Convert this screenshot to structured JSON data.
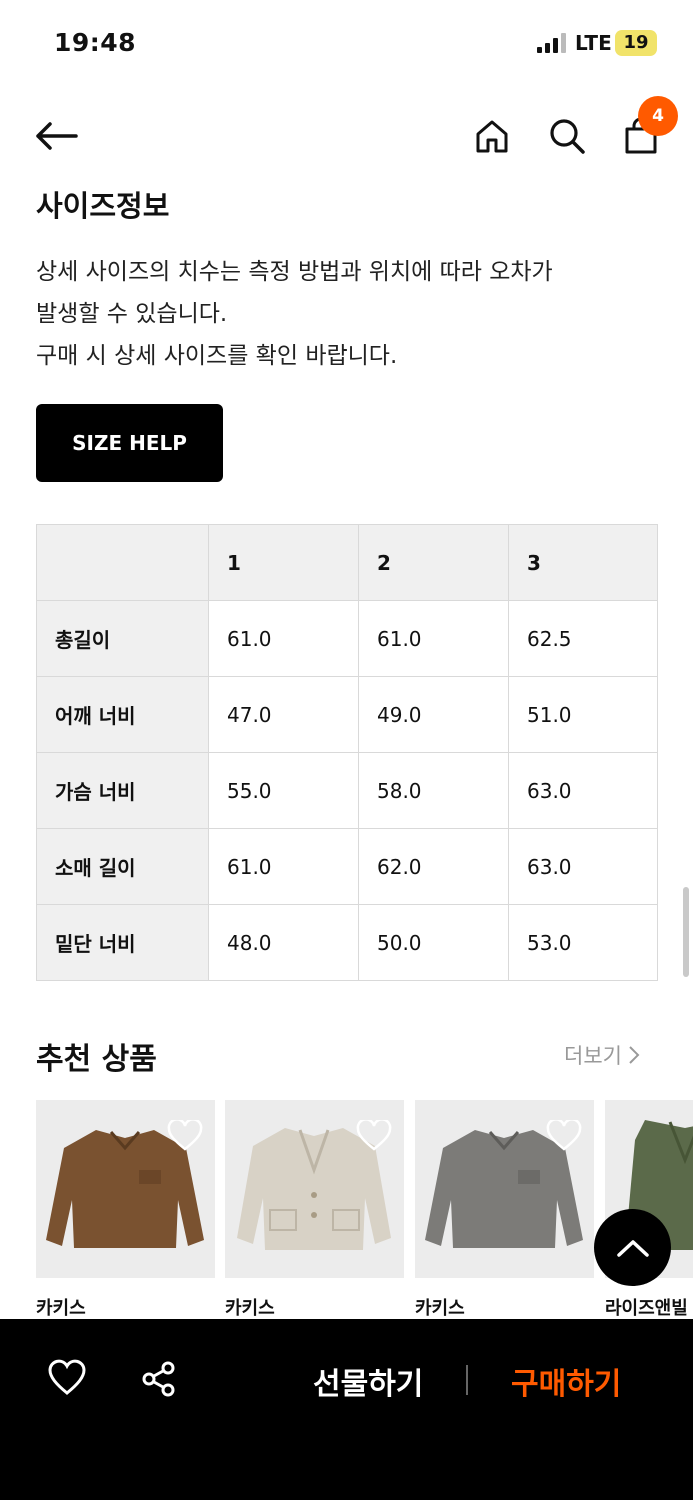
{
  "status": {
    "time": "19:48",
    "network": "LTE",
    "battery": "19"
  },
  "nav": {
    "cart_count": "4"
  },
  "size_section": {
    "title": "사이즈정보",
    "description": [
      "상세 사이즈의 치수는 측정 방법과 위치에 따라 오차가",
      "발생할 수 있습니다.",
      "구매 시 상세 사이즈를 확인 바랍니다."
    ],
    "help_button": "SIZE HELP"
  },
  "size_table": {
    "headers": [
      "",
      "1",
      "2",
      "3"
    ],
    "rows": [
      {
        "label": "총길이",
        "values": [
          "61.0",
          "61.0",
          "62.5"
        ]
      },
      {
        "label": "어깨 너비",
        "values": [
          "47.0",
          "49.0",
          "51.0"
        ]
      },
      {
        "label": "가슴 너비",
        "values": [
          "55.0",
          "58.0",
          "63.0"
        ]
      },
      {
        "label": "소매 길이",
        "values": [
          "61.0",
          "62.0",
          "63.0"
        ]
      },
      {
        "label": "밑단 너비",
        "values": [
          "48.0",
          "50.0",
          "53.0"
        ]
      }
    ]
  },
  "recommend": {
    "title": "추천 상품",
    "more": "더보기",
    "products": [
      {
        "brand": "카키스",
        "color": "#7a5230"
      },
      {
        "brand": "카키스",
        "color": "#d8d2c6"
      },
      {
        "brand": "카키스",
        "color": "#7c7b78"
      },
      {
        "brand": "라이즈앤빌",
        "color": "#5b6a4a"
      }
    ]
  },
  "bottom_bar": {
    "gift": "선물하기",
    "buy": "구매하기"
  },
  "colors": {
    "accent": "#ff5a00",
    "black": "#000000"
  }
}
